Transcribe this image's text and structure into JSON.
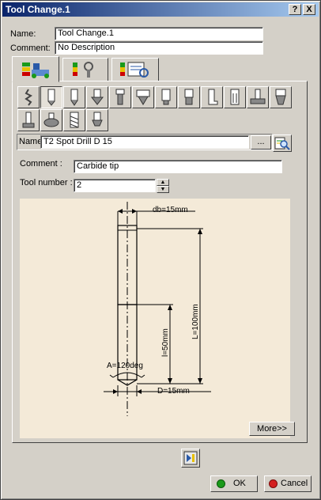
{
  "window": {
    "title": "Tool Change.1"
  },
  "titlebar": {
    "help_label": "?",
    "close_label": "X"
  },
  "form": {
    "name_label": "Name:",
    "name_value": "Tool Change.1",
    "comment_label": "Comment:",
    "comment_value": "No Description"
  },
  "tool": {
    "name_label": "Name",
    "name_value": "T2 Spot Drill D 15",
    "browse_label": "...",
    "comment_label": "Comment :",
    "comment_value": "Carbide tip",
    "number_label": "Tool number :",
    "number_value": "2"
  },
  "drawing": {
    "db": "db=15mm",
    "L": "L=100mm",
    "l": "l=50mm",
    "A": "A=120deg",
    "D": "D=15mm"
  },
  "buttons": {
    "more_label": "More>>",
    "ok_label": "OK",
    "cancel_label": "Cancel"
  },
  "colors": {
    "ok_icon": "#1a9a1a",
    "cancel_icon": "#d42020",
    "title_start": "#0a246a",
    "title_end": "#a6caf0"
  }
}
